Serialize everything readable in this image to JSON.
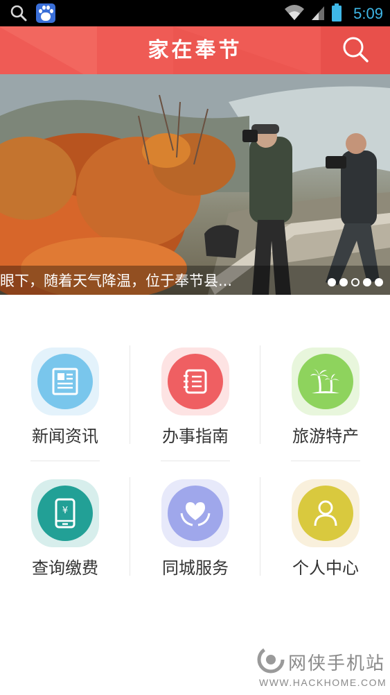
{
  "status_bar": {
    "time": "5:09",
    "colors": {
      "clock": "#3fb8e8",
      "background": "#000000"
    },
    "icons": [
      "search-icon",
      "baidu-app-icon",
      "wifi-icon",
      "signal-icon",
      "battery-icon"
    ]
  },
  "header": {
    "title": "家在奉节",
    "background": "#ef5b55",
    "search_icon": "search-icon"
  },
  "banner": {
    "caption": "眼下，随着天气降温，位于奉节县...",
    "slide_count": 5,
    "active_slide": 1
  },
  "menu": [
    {
      "label": "新闻资讯",
      "icon": "news-icon",
      "color": "#79c6ec",
      "halo": "#e3f2fb"
    },
    {
      "label": "办事指南",
      "icon": "guide-icon",
      "color": "#ef5f62",
      "halo": "#fde3e3"
    },
    {
      "label": "旅游特产",
      "icon": "palm-tree-icon",
      "color": "#8ed35d",
      "halo": "#e8f6dc"
    },
    {
      "label": "查询缴费",
      "icon": "phone-payment-icon",
      "color": "#22a096",
      "halo": "#d7eeec"
    },
    {
      "label": "同城服务",
      "icon": "heart-hands-icon",
      "color": "#9fa7eb",
      "halo": "#e7e9fa"
    },
    {
      "label": "个人中心",
      "icon": "user-icon",
      "color": "#d9c93e",
      "halo": "#f9f0dc"
    }
  ],
  "watermark": {
    "name": "网侠手机站",
    "url": "WWW.HACKHOME.COM"
  }
}
